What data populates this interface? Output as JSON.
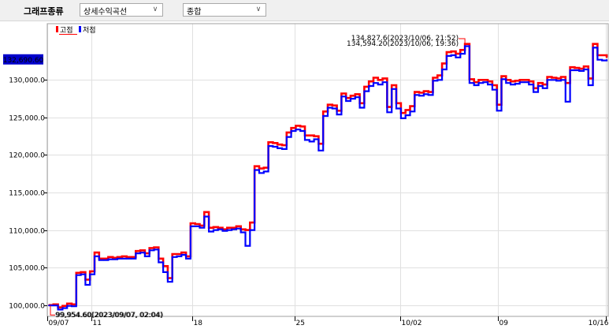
{
  "toolbar": {
    "graph_type_label": "그래프종류",
    "curve_select": {
      "value": "상세수익곡선"
    },
    "scope_select": {
      "value": "종합"
    }
  },
  "colors": {
    "high": "#ff0000",
    "low": "#0000ff",
    "current_bg": "#0000cc",
    "grid": "#e0e0e0"
  },
  "chart_data": {
    "type": "line",
    "legend": [
      {
        "name": "고점",
        "color": "#ff0000"
      },
      {
        "name": "저점",
        "color": "#0000ff"
      }
    ],
    "current_value_label": "132,690.60",
    "current_value": 132690.6,
    "ylim": [
      98500,
      137500
    ],
    "y_ticks": [
      100000,
      105000,
      110000,
      115000,
      120000,
      125000,
      130000
    ],
    "y_tick_labels": [
      "100,000.0",
      "105,000.0",
      "110,000.0",
      "115,000.0",
      "120,000.0",
      "125,000.0",
      "130,000.0"
    ],
    "x_tick_labels": [
      "09/07",
      "11",
      "18",
      "25",
      "10/02",
      "09",
      "10/16"
    ],
    "annotations": {
      "max_high": "134,827.6(2023/10/06, 21:52)",
      "max_low": "134,594.20(2023/10/06, 19:36)",
      "min": "99,954.60(2023/09/07, 02:04)"
    },
    "series": [
      {
        "name": "고점",
        "values": [
          100000,
          100100,
          99700,
          99900,
          100200,
          100100,
          104300,
          104400,
          103400,
          104500,
          107000,
          106200,
          106200,
          106400,
          106300,
          106400,
          106500,
          106400,
          106400,
          107200,
          107300,
          106900,
          107600,
          107700,
          106200,
          105200,
          103600,
          106800,
          106800,
          107000,
          106500,
          110900,
          110800,
          110600,
          112400,
          110300,
          110400,
          110300,
          110100,
          110300,
          110300,
          110500,
          110100,
          110000,
          111000,
          118500,
          118200,
          118300,
          121700,
          121600,
          121400,
          121300,
          123000,
          123600,
          123900,
          123800,
          122600,
          122600,
          122500,
          121500,
          125800,
          126700,
          126600,
          125900,
          128200,
          127600,
          127900,
          128100,
          126900,
          129100,
          129800,
          130300,
          130000,
          130200,
          126400,
          129300,
          126900,
          125600,
          126000,
          126500,
          128400,
          128300,
          128500,
          128400,
          130300,
          130600,
          132200,
          133700,
          133800,
          133500,
          134000,
          134800,
          130100,
          129700,
          130000,
          130000,
          129800,
          129300,
          126700,
          130500,
          130000,
          129800,
          129900,
          130000,
          130000,
          129800,
          128900,
          129600,
          129400,
          130400,
          130300,
          130200,
          130400,
          129600,
          131700,
          131600,
          131500,
          131800,
          130200,
          134800,
          133300,
          133300,
          133000
        ]
      },
      {
        "name": "저점",
        "values": [
          99950,
          99950,
          99400,
          99600,
          99900,
          99850,
          104000,
          104100,
          102700,
          104100,
          106500,
          106000,
          106000,
          106100,
          106100,
          106200,
          106200,
          106200,
          106200,
          106900,
          107000,
          106500,
          107300,
          107400,
          105700,
          104400,
          103100,
          106400,
          106500,
          106700,
          106200,
          110500,
          110500,
          110300,
          111800,
          109800,
          110000,
          110100,
          109900,
          110000,
          110100,
          110200,
          109700,
          107900,
          110000,
          118000,
          117600,
          117800,
          121200,
          121100,
          120900,
          120800,
          122400,
          123200,
          123400,
          123200,
          122000,
          121800,
          122100,
          120600,
          125200,
          126300,
          126200,
          125400,
          127800,
          127200,
          127500,
          127700,
          126300,
          128500,
          129200,
          129600,
          129400,
          129700,
          125700,
          128800,
          126200,
          124900,
          125300,
          125800,
          128000,
          127900,
          128100,
          128000,
          129900,
          130000,
          131400,
          133200,
          133300,
          133000,
          133500,
          134500,
          129600,
          129300,
          129600,
          129700,
          129400,
          128700,
          125900,
          130100,
          129600,
          129400,
          129500,
          129700,
          129700,
          129400,
          128400,
          129200,
          128900,
          130000,
          130000,
          129900,
          130000,
          127100,
          131300,
          131300,
          131200,
          131400,
          129300,
          134300,
          132700,
          132600,
          132690.6
        ]
      }
    ]
  }
}
